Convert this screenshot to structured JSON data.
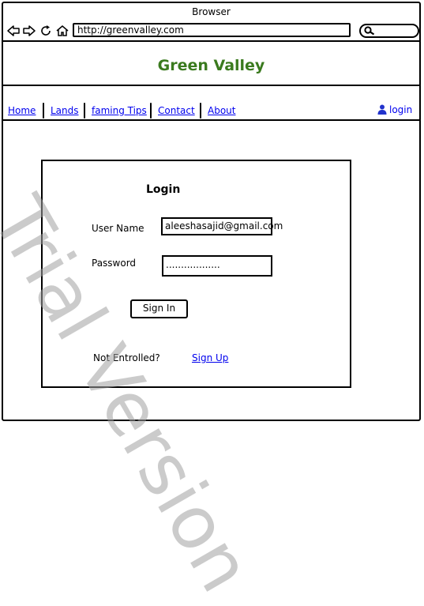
{
  "window": {
    "title": "Browser"
  },
  "toolbar": {
    "back_icon": "back-arrow-icon",
    "forward_icon": "forward-arrow-icon",
    "refresh_icon": "refresh-icon",
    "home_icon": "home-icon",
    "address": "http://greenvalley.com",
    "search_icon": "search-icon"
  },
  "site": {
    "title": "Green Valley",
    "title_color": "#3a7a1e"
  },
  "menu": {
    "items": [
      {
        "label": "Home"
      },
      {
        "label": "Lands"
      },
      {
        "label": "faming Tips"
      },
      {
        "label": "Contact"
      },
      {
        "label": "About"
      }
    ],
    "login_label": "login",
    "login_icon": "user-icon",
    "link_color": "#0000ee"
  },
  "login_form": {
    "title": "Login",
    "username_label": "User Name",
    "username_value": "aleeshasajid@gmail.com",
    "password_label": "Password",
    "password_value": "..................",
    "signin_label": "Sign In",
    "not_enrolled_text": "Not Entrolled?",
    "signup_label": "Sign Up"
  },
  "watermark": "Trial Version"
}
